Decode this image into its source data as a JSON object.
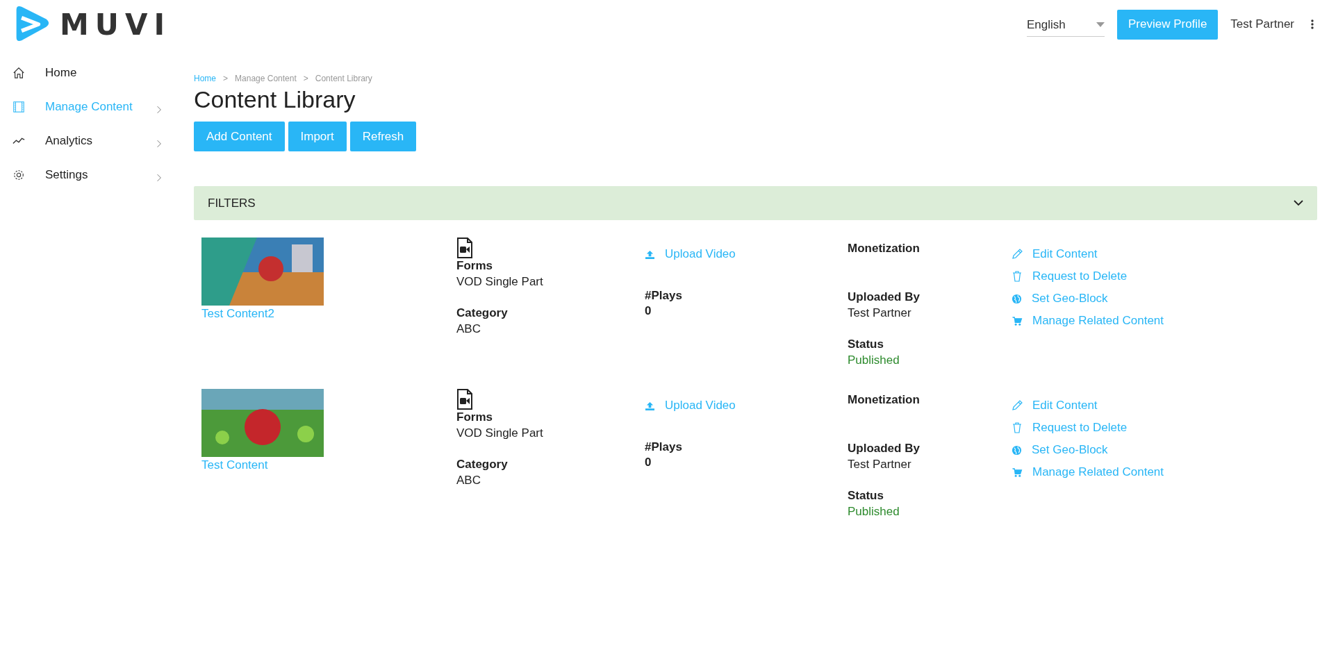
{
  "logo": {
    "text": "MUVI"
  },
  "header": {
    "language": "English",
    "preview_button": "Preview Profile",
    "user": "Test Partner"
  },
  "sidebar": {
    "items": [
      {
        "label": "Home",
        "has_submenu": false,
        "selected": false
      },
      {
        "label": "Manage Content",
        "has_submenu": true,
        "selected": true
      },
      {
        "label": "Analytics",
        "has_submenu": true,
        "selected": false
      },
      {
        "label": "Settings",
        "has_submenu": true,
        "selected": false
      }
    ]
  },
  "breadcrumb": [
    {
      "label": "Home",
      "link": true
    },
    {
      "label": "Manage Content",
      "link": false
    },
    {
      "label": "Content Library",
      "link": false
    }
  ],
  "breadcrumb_separator": ">",
  "page_title": "Content Library",
  "buttons": [
    "Add Content",
    "Import",
    "Refresh"
  ],
  "filters": {
    "label": "FILTERS",
    "expanded": false
  },
  "content": [
    {
      "title": "Test Content2",
      "forms_label": "Forms",
      "forms": "VOD Single Part",
      "category_label": "Category",
      "category": "ABC",
      "upload": "Upload Video",
      "plays_label": "#Plays",
      "plays": "0",
      "monetization_label": "Monetization",
      "uploaded_by_label": "Uploaded By",
      "uploaded_by": "Test Partner",
      "status_label": "Status",
      "status": "Published",
      "actions": [
        {
          "label": "Edit Content"
        },
        {
          "label": "Request to Delete"
        },
        {
          "label": "Set Geo-Block"
        },
        {
          "label": "Manage Related Content"
        }
      ]
    },
    {
      "title": "Test Content",
      "forms_label": "Forms",
      "forms": "VOD Single Part",
      "category_label": "Category",
      "category": "ABC",
      "upload": "Upload Video",
      "plays_label": "#Plays",
      "plays": "0",
      "monetization_label": "Monetization",
      "uploaded_by_label": "Uploaded By",
      "uploaded_by": "Test Partner",
      "status_label": "Status",
      "status": "Published",
      "actions": [
        {
          "label": "Edit Content"
        },
        {
          "label": "Request to Delete"
        },
        {
          "label": "Set Geo-Block"
        },
        {
          "label": "Manage Related Content"
        }
      ]
    }
  ]
}
